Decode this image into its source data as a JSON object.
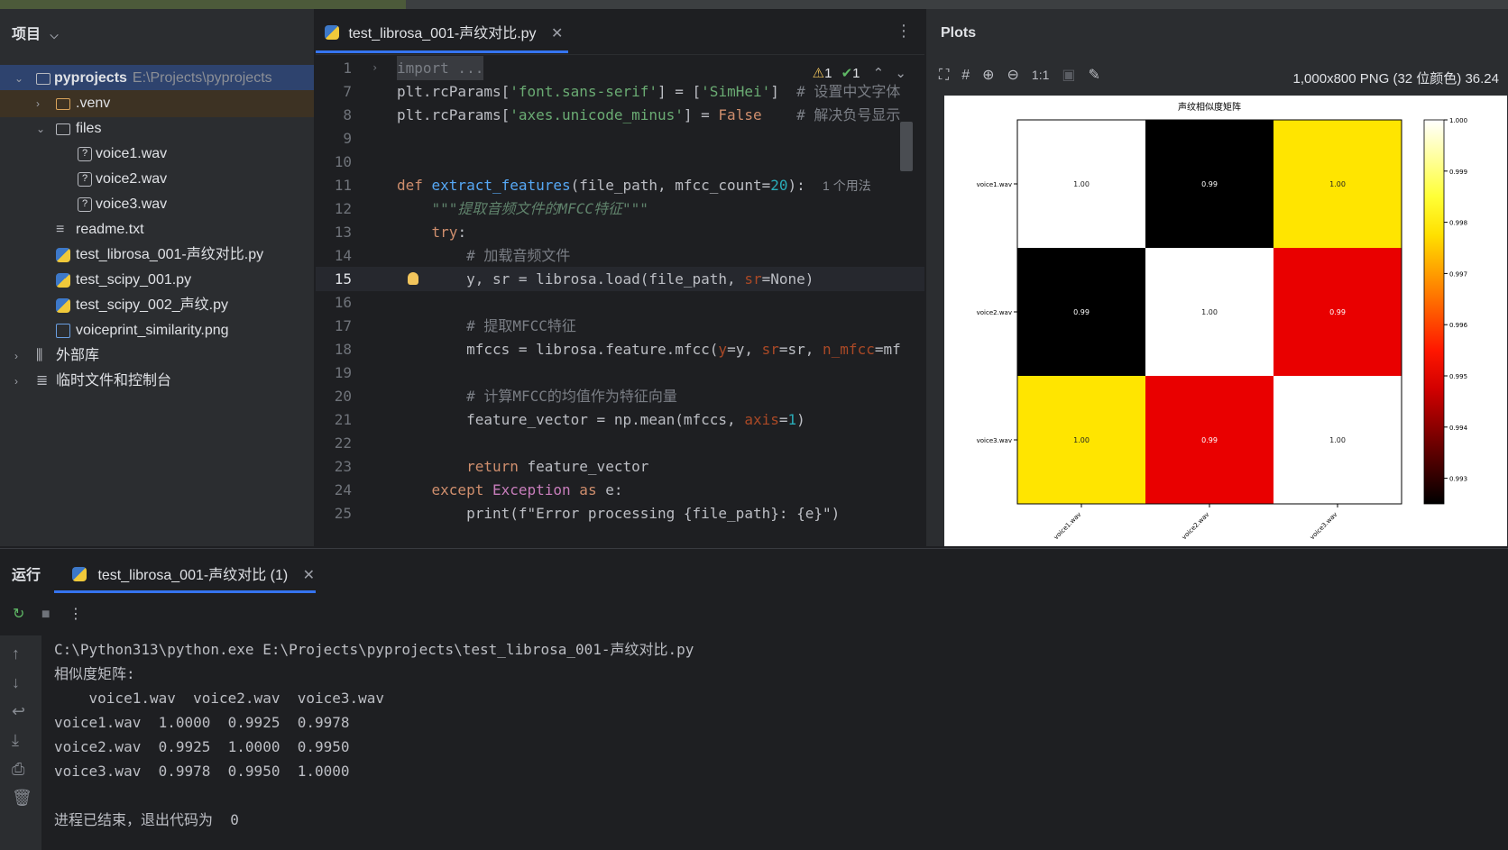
{
  "project": {
    "title": "项目",
    "items": [
      {
        "label": "pyprojects",
        "path": "E:\\Projects\\pyprojects",
        "type": "folder"
      },
      {
        "label": ".venv",
        "type": "folder"
      },
      {
        "label": "files",
        "type": "folder"
      },
      {
        "label": "voice1.wav",
        "type": "unknown"
      },
      {
        "label": "voice2.wav",
        "type": "unknown"
      },
      {
        "label": "voice3.wav",
        "type": "unknown"
      },
      {
        "label": "readme.txt",
        "type": "text"
      },
      {
        "label": "test_librosa_001-声纹对比.py",
        "type": "python"
      },
      {
        "label": "test_scipy_001.py",
        "type": "python"
      },
      {
        "label": "test_scipy_002_声纹.py",
        "type": "python"
      },
      {
        "label": "voiceprint_similarity.png",
        "type": "image"
      },
      {
        "label": "外部库",
        "type": "library"
      },
      {
        "label": "临时文件和控制台",
        "type": "scratch"
      }
    ]
  },
  "editor": {
    "tab_label": "test_librosa_001-声纹对比.py",
    "inspections": {
      "warnings": "1",
      "ok": "1"
    },
    "line_numbers": [
      "1",
      "7",
      "8",
      "9",
      "10",
      "11",
      "12",
      "13",
      "14",
      "15",
      "16",
      "17",
      "18",
      "19",
      "20",
      "21",
      "22",
      "23",
      "24",
      "25"
    ],
    "usage_hint": "1 个用法",
    "code": {
      "l1": "import ...",
      "l7a": "plt.rcParams[",
      "l7b": "'font.sans-serif'",
      "l7c": "] = [",
      "l7d": "'SimHei'",
      "l7e": "]  ",
      "l7f": "# 设置中文字体",
      "l8a": "plt.rcParams[",
      "l8b": "'axes.unicode_minus'",
      "l8c": "] = ",
      "l8d": "False",
      "l8e": "    ",
      "l8f": "# 解决负号显示",
      "l11a": "def ",
      "l11b": "extract_features",
      "l11c": "(file_path, mfcc_count=",
      "l11d": "20",
      "l11e": "):  ",
      "l12": "    \"\"\"提取音频文件的MFCC特征\"\"\"",
      "l13a": "    try",
      "l13b": ":",
      "l14": "        # 加载音频文件",
      "l15a": "        y, sr = librosa.load(file_path, ",
      "l15b": "sr",
      "l15c": "=None)",
      "l17": "        # 提取MFCC特征",
      "l18a": "        mfccs = librosa.feature.mfcc(",
      "l18b": "y",
      "l18c": "=y, ",
      "l18d": "sr",
      "l18e": "=sr, ",
      "l18f": "n_mfcc",
      "l18g": "=mf",
      "l20": "        # 计算MFCC的均值作为特征向量",
      "l21a": "        feature_vector = np.mean(mfccs, ",
      "l21b": "axis",
      "l21c": "=",
      "l21d": "1",
      "l21e": ")",
      "l23a": "        return",
      "l23b": " feature_vector",
      "l24a": "    except ",
      "l24b": "Exception",
      "l24c": " as ",
      "l24d": "e:",
      "l25": "        print(f\"Error processing {file_path}: {e}\")"
    }
  },
  "plots": {
    "title": "Plots",
    "zoom_label": "1:1",
    "info": "1,000x800 PNG (32 位颜色) 36.24"
  },
  "chart_data": {
    "type": "heatmap",
    "title": "声纹相似度矩阵",
    "x_labels": [
      "voice1.wav",
      "voice2.wav",
      "voice3.wav"
    ],
    "y_labels": [
      "voice1.wav",
      "voice2.wav",
      "voice3.wav"
    ],
    "values": [
      [
        1.0,
        0.9925,
        0.9978
      ],
      [
        0.9925,
        1.0,
        0.995
      ],
      [
        0.9978,
        0.995,
        1.0
      ]
    ],
    "cell_labels": [
      [
        "1.00",
        "0.99",
        "1.00"
      ],
      [
        "0.99",
        "1.00",
        "0.99"
      ],
      [
        "1.00",
        "0.99",
        "1.00"
      ]
    ],
    "colorbar_ticks": [
      "1.000",
      "0.999",
      "0.998",
      "0.997",
      "0.996",
      "0.995",
      "0.994",
      "0.993"
    ],
    "colormap": "hot"
  },
  "run": {
    "label": "运行",
    "tab_label": "test_librosa_001-声纹对比 (1)",
    "console": [
      "C:\\Python313\\python.exe E:\\Projects\\pyprojects\\test_librosa_001-声纹对比.py",
      "相似度矩阵:",
      "    voice1.wav  voice2.wav  voice3.wav",
      "voice1.wav  1.0000  0.9925  0.9978",
      "voice2.wav  0.9925  1.0000  0.9950",
      "voice3.wav  0.9978  0.9950  1.0000",
      "",
      "进程已结束，退出代码为  0"
    ]
  }
}
